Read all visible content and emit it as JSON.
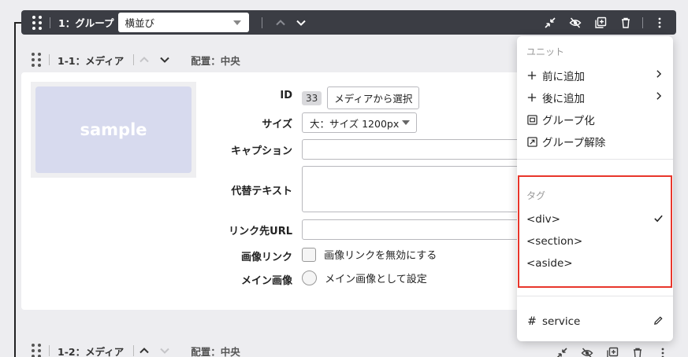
{
  "group": {
    "title": "1：グループ",
    "layout_value": "横並び"
  },
  "unit1": {
    "title": "1-1：メディア",
    "position": "配置：中央",
    "thumbnail_text": "sample",
    "id_label": "ID",
    "id_value": "33",
    "select_media_button": "メディアから選択",
    "size_label": "サイズ",
    "size_value": "大：サイズ 1200px",
    "caption_label": "キャプション",
    "caption_value": "",
    "alt_label": "代替テキスト",
    "alt_value": "",
    "link_label": "リンク先URL",
    "link_value": "",
    "image_link_label": "画像リンク",
    "image_link_option": "画像リンクを無効にする",
    "main_image_label": "メイン画像",
    "main_image_option": "メイン画像として設定"
  },
  "unit2": {
    "title": "1-2：メディア",
    "position": "配置：中央"
  },
  "menu": {
    "unit_heading": "ユニット",
    "items": [
      {
        "label": "前に追加"
      },
      {
        "label": "後に追加"
      },
      {
        "label": "グループ化"
      },
      {
        "label": "グループ解除"
      }
    ],
    "tag_heading": "タグ",
    "tags": [
      {
        "label": "<div>",
        "selected": true
      },
      {
        "label": "<section>",
        "selected": false
      },
      {
        "label": "<aside>",
        "selected": false
      }
    ],
    "anchor_label": "service"
  },
  "colors": {
    "toolbar_bg": "#3b3d44",
    "highlight": "#e8362b",
    "thumbnail_bg": "#d7daee"
  }
}
